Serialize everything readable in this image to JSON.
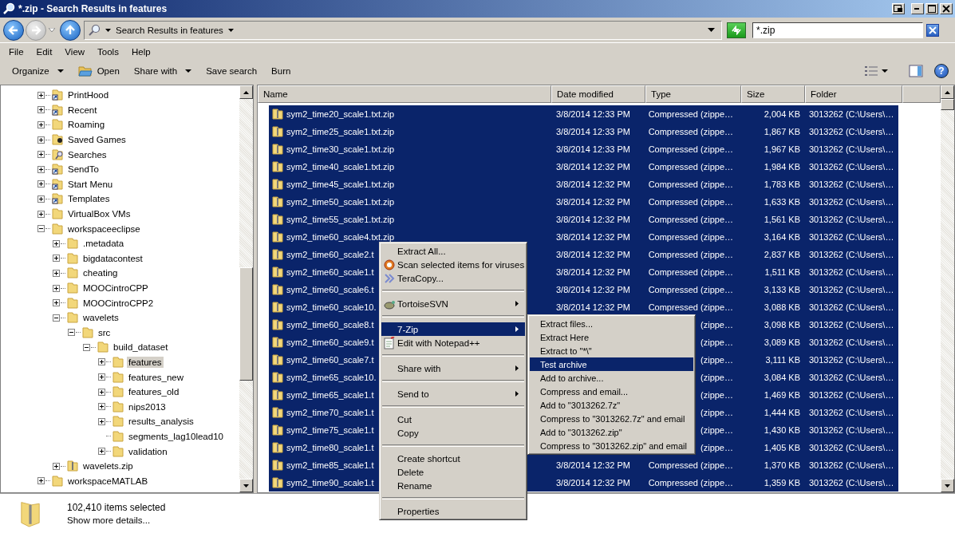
{
  "window": {
    "title": "*.zip - Search Results in features"
  },
  "address_bar": {
    "breadcrumb": "Search Results in features",
    "forward_disabled": true
  },
  "search": {
    "value": "*.zip"
  },
  "menu_bar": [
    "File",
    "Edit",
    "View",
    "Tools",
    "Help"
  ],
  "toolbar": [
    {
      "label": "Organize",
      "kind": "dropdown"
    },
    {
      "label": "Open",
      "kind": "open"
    },
    {
      "label": "Share with",
      "kind": "dropdown"
    },
    {
      "label": "Save search",
      "kind": "plain"
    },
    {
      "label": "Burn",
      "kind": "plain"
    }
  ],
  "help_button": {
    "label": "?"
  },
  "tree": [
    {
      "label": "PrintHood",
      "kind": "shortcut",
      "expanded": false,
      "selected": false
    },
    {
      "label": "Recent",
      "kind": "shortcut",
      "expanded": false,
      "selected": false
    },
    {
      "label": "Roaming",
      "kind": "folder",
      "expanded": false,
      "selected": false
    },
    {
      "label": "Saved Games",
      "kind": "games",
      "expanded": false,
      "selected": false
    },
    {
      "label": "Searches",
      "kind": "search",
      "expanded": false,
      "selected": false
    },
    {
      "label": "SendTo",
      "kind": "shortcut",
      "expanded": false,
      "selected": false
    },
    {
      "label": "Start Menu",
      "kind": "shortcut",
      "expanded": false,
      "selected": false
    },
    {
      "label": "Templates",
      "kind": "shortcut",
      "expanded": false,
      "selected": false
    },
    {
      "label": "VirtualBox VMs",
      "kind": "folder",
      "expanded": false,
      "selected": false
    },
    {
      "label": "workspaceeclipse",
      "kind": "folder",
      "expanded": true,
      "selected": false,
      "children": [
        {
          "label": ".metadata",
          "kind": "folder",
          "expanded": false,
          "selected": false
        },
        {
          "label": "bigdatacontest",
          "kind": "folder",
          "expanded": false,
          "selected": false
        },
        {
          "label": "cheating",
          "kind": "folder",
          "expanded": false,
          "selected": false
        },
        {
          "label": "MOOCintroCPP",
          "kind": "folder",
          "expanded": false,
          "selected": false
        },
        {
          "label": "MOOCintroCPP2",
          "kind": "folder",
          "expanded": false,
          "selected": false
        },
        {
          "label": "wavelets",
          "kind": "folder",
          "expanded": true,
          "selected": false,
          "children": [
            {
              "label": "src",
              "kind": "folder",
              "expanded": true,
              "selected": false,
              "children": [
                {
                  "label": "build_dataset",
                  "kind": "folder",
                  "expanded": true,
                  "selected": false,
                  "children": [
                    {
                      "label": "features",
                      "kind": "folder",
                      "expanded": false,
                      "selected": true
                    },
                    {
                      "label": "features_new",
                      "kind": "folder",
                      "expanded": false,
                      "selected": false
                    },
                    {
                      "label": "features_old",
                      "kind": "folder",
                      "expanded": false,
                      "selected": false
                    },
                    {
                      "label": "nips2013",
                      "kind": "folder",
                      "expanded": false,
                      "selected": false
                    },
                    {
                      "label": "results_analysis",
                      "kind": "folder",
                      "expanded": false,
                      "selected": false
                    },
                    {
                      "label": "segments_lag10lead10",
                      "kind": "leaf",
                      "selected": false
                    },
                    {
                      "label": "validation",
                      "kind": "folder",
                      "expanded": false,
                      "selected": false
                    }
                  ]
                }
              ]
            }
          ]
        },
        {
          "label": "wavelets.zip",
          "kind": "zip",
          "expanded": false,
          "selected": false
        }
      ]
    },
    {
      "label": "workspaceMATLAB",
      "kind": "folder",
      "expanded": false,
      "selected": false
    }
  ],
  "table": {
    "columns": [
      "Name",
      "Date modified",
      "Type",
      "Size",
      "Folder"
    ],
    "rows": [
      {
        "name": "sym2_time20_scale1.txt.zip",
        "date": "3/8/2014 12:33 PM",
        "type": "Compressed (zippe…",
        "size": "2,004 KB",
        "folder": "3013262 (C:\\Users\\…",
        "selected": true
      },
      {
        "name": "sym2_time25_scale1.txt.zip",
        "date": "3/8/2014 12:33 PM",
        "type": "Compressed (zippe…",
        "size": "1,867 KB",
        "folder": "3013262 (C:\\Users\\…",
        "selected": true
      },
      {
        "name": "sym2_time30_scale1.txt.zip",
        "date": "3/8/2014 12:33 PM",
        "type": "Compressed (zippe…",
        "size": "1,967 KB",
        "folder": "3013262 (C:\\Users\\…",
        "selected": true
      },
      {
        "name": "sym2_time40_scale1.txt.zip",
        "date": "3/8/2014 12:32 PM",
        "type": "Compressed (zippe…",
        "size": "1,984 KB",
        "folder": "3013262 (C:\\Users\\…",
        "selected": true
      },
      {
        "name": "sym2_time45_scale1.txt.zip",
        "date": "3/8/2014 12:32 PM",
        "type": "Compressed (zippe…",
        "size": "1,783 KB",
        "folder": "3013262 (C:\\Users\\…",
        "selected": true
      },
      {
        "name": "sym2_time50_scale1.txt.zip",
        "date": "3/8/2014 12:32 PM",
        "type": "Compressed (zippe…",
        "size": "1,633 KB",
        "folder": "3013262 (C:\\Users\\…",
        "selected": true
      },
      {
        "name": "sym2_time55_scale1.txt.zip",
        "date": "3/8/2014 12:32 PM",
        "type": "Compressed (zippe…",
        "size": "1,561 KB",
        "folder": "3013262 (C:\\Users\\…",
        "selected": true
      },
      {
        "name": "sym2_time60_scale4.txt.zip",
        "date": "3/8/2014 12:32 PM",
        "type": "Compressed (zippe…",
        "size": "3,164 KB",
        "folder": "3013262 (C:\\Users\\…",
        "selected": true
      },
      {
        "name": "sym2_time60_scale2.t",
        "date": "3/8/2014 12:32 PM",
        "type": "Compressed (zippe…",
        "size": "2,837 KB",
        "folder": "3013262 (C:\\Users\\…",
        "selected": true
      },
      {
        "name": "sym2_time60_scale1.t",
        "date": "3/8/2014 12:32 PM",
        "type": "Compressed (zippe…",
        "size": "1,511 KB",
        "folder": "3013262 (C:\\Users\\…",
        "selected": true
      },
      {
        "name": "sym2_time60_scale6.t",
        "date": "3/8/2014 12:32 PM",
        "type": "Compressed (zippe…",
        "size": "3,133 KB",
        "folder": "3013262 (C:\\Users\\…",
        "selected": true
      },
      {
        "name": "sym2_time60_scale10.",
        "date": "3/8/2014 12:32 PM",
        "type": "Compressed (zippe…",
        "size": "3,088 KB",
        "folder": "3013262 (C:\\Users\\…",
        "selected": true
      },
      {
        "name": "sym2_time60_scale8.t",
        "type": "(zippe…",
        "size": "3,098 KB",
        "folder": "3013262 (C:\\Users\\…",
        "selected": true
      },
      {
        "name": "sym2_time60_scale9.t",
        "type": "(zippe…",
        "size": "3,089 KB",
        "folder": "3013262 (C:\\Users\\…",
        "selected": true
      },
      {
        "name": "sym2_time60_scale7.t",
        "type": "(zippe…",
        "size": "3,111 KB",
        "folder": "3013262 (C:\\Users\\…",
        "selected": true
      },
      {
        "name": "sym2_time65_scale10.",
        "type": "(zippe…",
        "size": "3,084 KB",
        "folder": "3013262 (C:\\Users\\…",
        "selected": true
      },
      {
        "name": "sym2_time65_scale1.t",
        "type": "(zippe…",
        "size": "1,469 KB",
        "folder": "3013262 (C:\\Users\\…",
        "selected": true
      },
      {
        "name": "sym2_time70_scale1.t",
        "type": "(zippe…",
        "size": "1,444 KB",
        "folder": "3013262 (C:\\Users\\…",
        "selected": true
      },
      {
        "name": "sym2_time75_scale1.t",
        "type": "(zippe…",
        "size": "1,430 KB",
        "folder": "3013262 (C:\\Users\\…",
        "selected": true
      },
      {
        "name": "sym2_time80_scale1.t",
        "type": "(zippe…",
        "size": "1,405 KB",
        "folder": "3013262 (C:\\Users\\…",
        "selected": true
      },
      {
        "name": "sym2_time85_scale1.t",
        "date": "3/8/2014 12:32 PM",
        "type": "Compressed (zippe…",
        "size": "1,370 KB",
        "folder": "3013262 (C:\\Users\\…",
        "selected": true
      },
      {
        "name": "sym2_time90_scale1.t",
        "date": "3/8/2014 12:32 PM",
        "type": "Compressed (zippe…",
        "size": "1,359 KB",
        "folder": "3013262 (C:\\Users\\…",
        "selected": true
      }
    ]
  },
  "context_menu": [
    {
      "kind": "plain",
      "label": "Extract All...",
      "selected": false
    },
    {
      "kind": "scan",
      "label": "Scan selected items for viruses",
      "selected": false
    },
    {
      "kind": "teracopy",
      "label": "TeraCopy...",
      "selected": false
    },
    {
      "kind": "separator"
    },
    {
      "kind": "tortoise",
      "label": "TortoiseSVN",
      "selected": false
    },
    {
      "kind": "separator"
    },
    {
      "kind": "submenu",
      "label": "7-Zip",
      "selected": true
    },
    {
      "kind": "notepad",
      "label": "Edit with Notepad++",
      "selected": false
    },
    {
      "kind": "separator"
    },
    {
      "kind": "submenu",
      "label": "Share with",
      "selected": false
    },
    {
      "kind": "separator"
    },
    {
      "kind": "submenu",
      "label": "Send to",
      "selected": false
    },
    {
      "kind": "separator"
    },
    {
      "kind": "plain",
      "label": "Cut",
      "selected": false
    },
    {
      "kind": "plain",
      "label": "Copy",
      "selected": false
    },
    {
      "kind": "separator"
    },
    {
      "kind": "plain",
      "label": "Create shortcut",
      "selected": false
    },
    {
      "kind": "plain",
      "label": "Delete",
      "selected": false
    },
    {
      "kind": "plain",
      "label": "Rename",
      "selected": false
    },
    {
      "kind": "separator"
    },
    {
      "kind": "plain",
      "label": "Properties",
      "selected": false
    }
  ],
  "submenu": [
    {
      "label": "Extract files...",
      "selected": false
    },
    {
      "label": "Extract Here",
      "selected": false
    },
    {
      "label": "Extract to \"*\\\"",
      "selected": false
    },
    {
      "label": "Test archive",
      "selected": true
    },
    {
      "label": "Add to archive...",
      "selected": false
    },
    {
      "label": "Compress and email...",
      "selected": false
    },
    {
      "label": "Add to \"3013262.7z\"",
      "selected": false
    },
    {
      "label": "Compress to \"3013262.7z\" and email",
      "selected": false
    },
    {
      "label": "Add to \"3013262.zip\"",
      "selected": false
    },
    {
      "label": "Compress to \"3013262.zip\" and email",
      "selected": false
    }
  ],
  "details_pane": {
    "summary": "102,410 items selected",
    "link": "Show more details..."
  }
}
